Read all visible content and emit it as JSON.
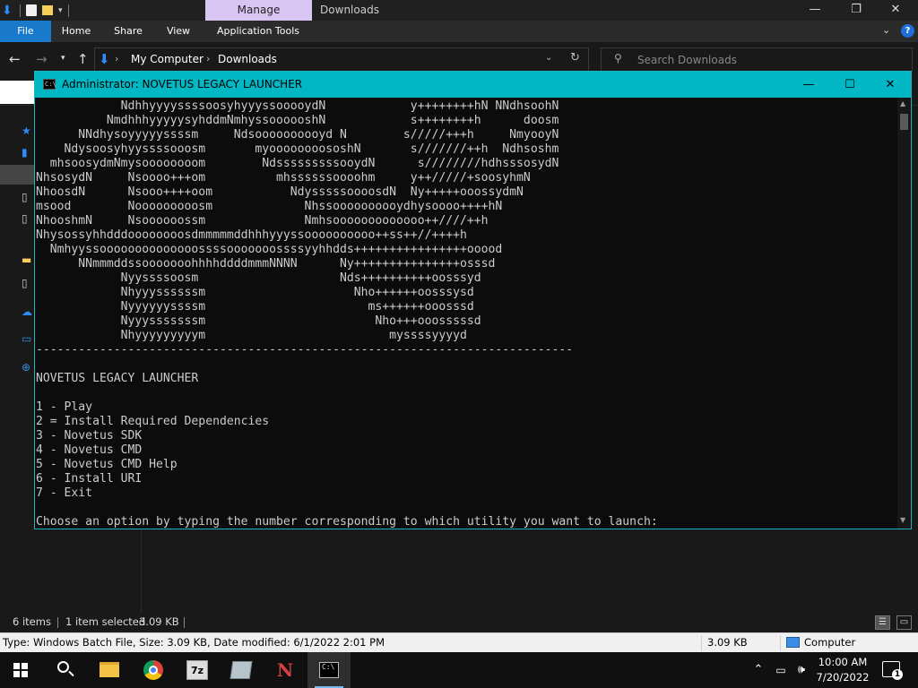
{
  "explorer": {
    "context_tab": "Manage",
    "window_title": "Downloads",
    "ribbon_tabs": [
      "File",
      "Home",
      "Share",
      "View",
      "Application Tools"
    ],
    "address": {
      "crumbs": [
        "My Computer",
        "Downloads"
      ]
    },
    "search_placeholder": "Search Downloads",
    "status": {
      "items_count": "6 items",
      "selected": "1 item selected",
      "selected_size": "3.09 KB"
    },
    "details": {
      "type_info": "Type: Windows Batch File, Size: 3.09 KB, Date modified: 6/1/2022 2:01 PM",
      "size": "3.09 KB",
      "location": "Computer"
    }
  },
  "console": {
    "title": "Administrator:  NOVETUS LEGACY LAUNCHER",
    "ascii_art": [
      "            NdhhyyyyssssoosyhyyyssooooydN            y++++++++hN NNdhsoohN",
      "          NmdhhhyyyyysyhddmNmhyssoooooshN            s++++++++h      doosm",
      "      NNdhysoyyyyyssssm     Ndsoooooooooyd N        s/////+++h     NmyooyN",
      "    Ndysoosyhyyssssooosm       myoooooooososhN       s///////++h  Ndhsoshm",
      "  mhsoosydmNmysoooooooom        NdsssssssssooydN      s////////hdhsssosydN",
      "NhsosydN     Nsoooo+++om          mhssssssoooohm     y++/////+soosyhmN",
      "NhoosdN      Nsooo++++oom           NdysssssoooosdN  Ny+++++ooossydmN",
      "msood        Nooooooooosm             Nhssoooooooooydhysoooo++++hN",
      "NhooshmN     Nsoooooossm              Nmhsooooooooooooo++////++h",
      "Nhysossyhhdddoooooooosdmmmmmddhhhyyyssoooooooooo++ss++//++++h",
      "  Nmhyyssoooooooooooooossssooooooossssyyhhdds++++++++++++++++ooood",
      "      NNmmmddssooooooohhhhddddmmmNNNN      Ny+++++++++++++++osssd",
      "            Nyyssssoosm                    Nds++++++++++oosssyd",
      "            Nhyyyssssssm                     Nho++++++oosssysd",
      "            Nyyyyyyssssm                       ms++++++ooosssd",
      "            Nyyysssssssm                        Nho+++ooosssssd",
      "            Nhyyyyyyyyym                          myssssyyyyd"
    ],
    "divider": "----------------------------------------------------------------------------",
    "heading": "NOVETUS LEGACY LAUNCHER",
    "options": [
      "1 - Play",
      "2 = Install Required Dependencies",
      "3 - Novetus SDK",
      "4 - Novetus CMD",
      "5 - Novetus CMD Help",
      "6 - Install URI",
      "7 - Exit"
    ],
    "prompt": "Choose an option by typing the number corresponding to which utility you want to launch:"
  },
  "taskbar": {
    "apps": [
      "windows-start",
      "search",
      "file-explorer",
      "chrome",
      "7-zip",
      "generic-app",
      "novetus",
      "command-prompt"
    ],
    "time": "10:00 AM",
    "date": "7/20/2022",
    "notification_count": "1"
  },
  "colors": {
    "console_title_bg": "#00b7c3",
    "console_bg": "#0c0c0c",
    "console_text": "#cccccc",
    "file_tab": "#1979ca",
    "manage_tab": "#d9c5f2",
    "status_bar": "#f0f0f0"
  }
}
